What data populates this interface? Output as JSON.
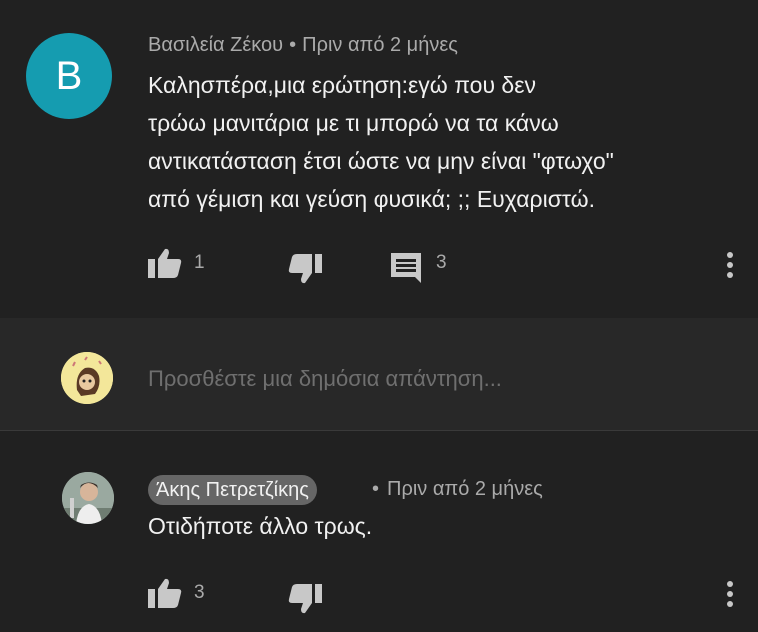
{
  "comment": {
    "author": "Βασιλεία Ζέκου",
    "separator": "•",
    "time": "Πριν από 2 μήνες",
    "avatar_letter": "B",
    "avatar_color": "#159cb0",
    "text_lines": [
      "Καλησπέρα,μια ερώτηση:εγώ που δεν",
      "τρώω μανιτάρια με τι μπορώ να τα κάνω",
      "αντικατάσταση έτσι ώστε να μην είναι \"φτωχο\"",
      "από γέμιση και γεύση φυσικά; ;; Ευχαριστώ."
    ],
    "likes": "1",
    "replies": "3"
  },
  "reply_box": {
    "placeholder": "Προσθέστε μια δημόσια απάντηση..."
  },
  "reply": {
    "author": "Άκης Πετρετζίκης",
    "separator": "•",
    "time": "Πριν από 2 μήνες",
    "text": "Οτιδήποτε άλλο τρως.",
    "likes": "3"
  },
  "icons": {
    "like": "thumbs-up-icon",
    "dislike": "thumbs-down-icon",
    "reply": "comment-icon",
    "menu": "more-vertical-icon"
  }
}
